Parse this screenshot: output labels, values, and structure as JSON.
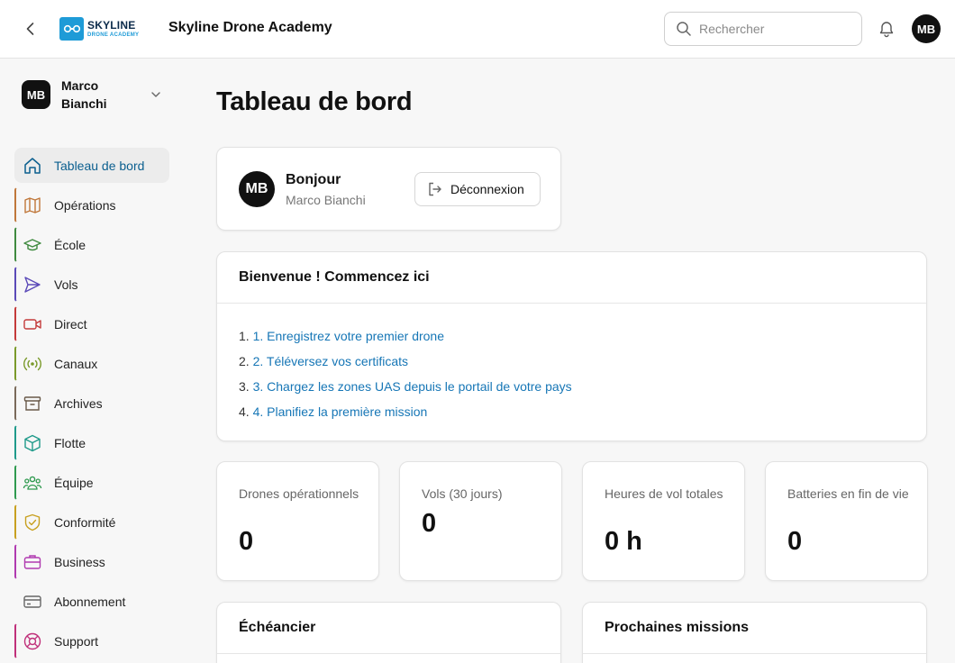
{
  "header": {
    "logo": {
      "line1": "SKYLINE",
      "line2": "DRONE ACADEMY"
    },
    "app_title": "Skyline Drone Academy",
    "search_placeholder": "Rechercher",
    "avatar_initials": "MB"
  },
  "sidebar": {
    "user": {
      "initials": "MB",
      "name": "Marco Bianchi"
    },
    "items": [
      {
        "label": "Tableau de bord",
        "icon": "home-icon",
        "color": "#0b5f8f",
        "active": true
      },
      {
        "label": "Opérations",
        "icon": "map-icon",
        "color": "#c0773a"
      },
      {
        "label": "École",
        "icon": "graduation-cap-icon",
        "color": "#3f8a3f"
      },
      {
        "label": "Vols",
        "icon": "send-icon",
        "color": "#5b4ab8"
      },
      {
        "label": "Direct",
        "icon": "video-icon",
        "color": "#c43a3a"
      },
      {
        "label": "Canaux",
        "icon": "broadcast-icon",
        "color": "#7a9a2a"
      },
      {
        "label": "Archives",
        "icon": "archive-icon",
        "color": "#7a6a5a"
      },
      {
        "label": "Flotte",
        "icon": "cube-icon",
        "color": "#1f9a8a"
      },
      {
        "label": "Équipe",
        "icon": "users-icon",
        "color": "#2f9a4f"
      },
      {
        "label": "Conformité",
        "icon": "shield-check-icon",
        "color": "#c8a020"
      },
      {
        "label": "Business",
        "icon": "briefcase-icon",
        "color": "#b03ab0"
      },
      {
        "label": "Abonnement",
        "icon": "credit-card-icon",
        "color": ""
      },
      {
        "label": "Support",
        "icon": "lifebuoy-icon",
        "color": "#c0307a"
      }
    ]
  },
  "main": {
    "page_title": "Tableau de bord",
    "greeting": {
      "initials": "MB",
      "hello": "Bonjour",
      "name": "Marco Bianchi",
      "logout_label": "Déconnexion"
    },
    "welcome": {
      "title": "Bienvenue ! Commencez ici",
      "steps": [
        {
          "num": "1.",
          "text": "1. Enregistrez votre premier drone"
        },
        {
          "num": "2.",
          "text": "2. Téléversez vos certificats"
        },
        {
          "num": "3.",
          "text": "3. Chargez les zones UAS depuis le portail de votre pays"
        },
        {
          "num": "4.",
          "text": "4. Planifiez la première mission"
        }
      ]
    },
    "stats": [
      {
        "label": "Drones opérationnels",
        "value": "0"
      },
      {
        "label": "Vols (30 jours)",
        "value": "0"
      },
      {
        "label": "Heures de vol totales",
        "value": "0 h"
      },
      {
        "label": "Batteries en fin de vie",
        "value": "0"
      }
    ],
    "panels": [
      {
        "title": "Échéancier"
      },
      {
        "title": "Prochaines missions"
      }
    ]
  }
}
